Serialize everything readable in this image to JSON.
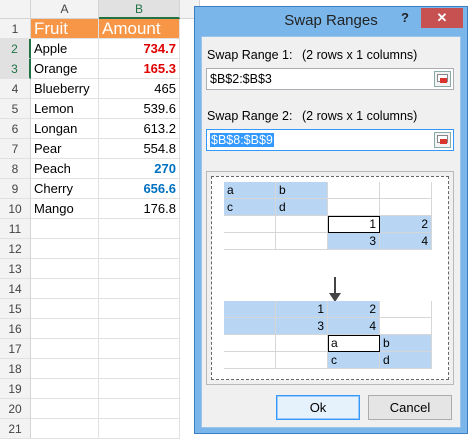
{
  "sheet": {
    "columns": [
      "A",
      "B"
    ],
    "rows": [
      "1",
      "2",
      "3",
      "4",
      "5",
      "6",
      "7",
      "8",
      "9",
      "10",
      "11",
      "12",
      "13",
      "14",
      "15",
      "16",
      "17",
      "18",
      "19",
      "20",
      "21"
    ],
    "header": {
      "a": "Fruit",
      "b": "Amount"
    },
    "data": [
      {
        "fruit": "Apple",
        "amount": "734.7"
      },
      {
        "fruit": "Orange",
        "amount": "165.3"
      },
      {
        "fruit": "Blueberry",
        "amount": "465"
      },
      {
        "fruit": "Lemon",
        "amount": "539.6"
      },
      {
        "fruit": "Longan",
        "amount": "613.2"
      },
      {
        "fruit": "Pear",
        "amount": "554.8"
      },
      {
        "fruit": "Peach",
        "amount": "270"
      },
      {
        "fruit": "Cherry",
        "amount": "656.6"
      },
      {
        "fruit": "Mango",
        "amount": "176.8"
      }
    ]
  },
  "dialog": {
    "title": "Swap Ranges",
    "help": "?",
    "close": "✕",
    "range1": {
      "label": "Swap Range 1:",
      "info": "(2 rows x 1 columns)",
      "value": "$B$2:$B$3"
    },
    "range2": {
      "label": "Swap Range 2:",
      "info": "(2 rows x 1 columns)",
      "value": "$B$8:$B$9"
    },
    "preview": {
      "top": [
        [
          "a",
          "b",
          "",
          ""
        ],
        [
          "c",
          "d",
          "",
          ""
        ],
        [
          "",
          "",
          "1",
          "2"
        ],
        [
          "",
          "",
          "3",
          "4"
        ]
      ],
      "bottom": [
        [
          "",
          "1",
          "2",
          ""
        ],
        [
          "",
          "3",
          "4",
          ""
        ],
        [
          "",
          "",
          "a",
          "b"
        ],
        [
          "",
          "",
          "c",
          "d"
        ]
      ]
    },
    "ok": "Ok",
    "cancel": "Cancel"
  },
  "colors": {
    "header_fill": "#f79646",
    "red_value": "#e00000",
    "blue_value": "#0070c0",
    "selection": "#3399ff",
    "preview_highlight": "#b8d6f4"
  }
}
